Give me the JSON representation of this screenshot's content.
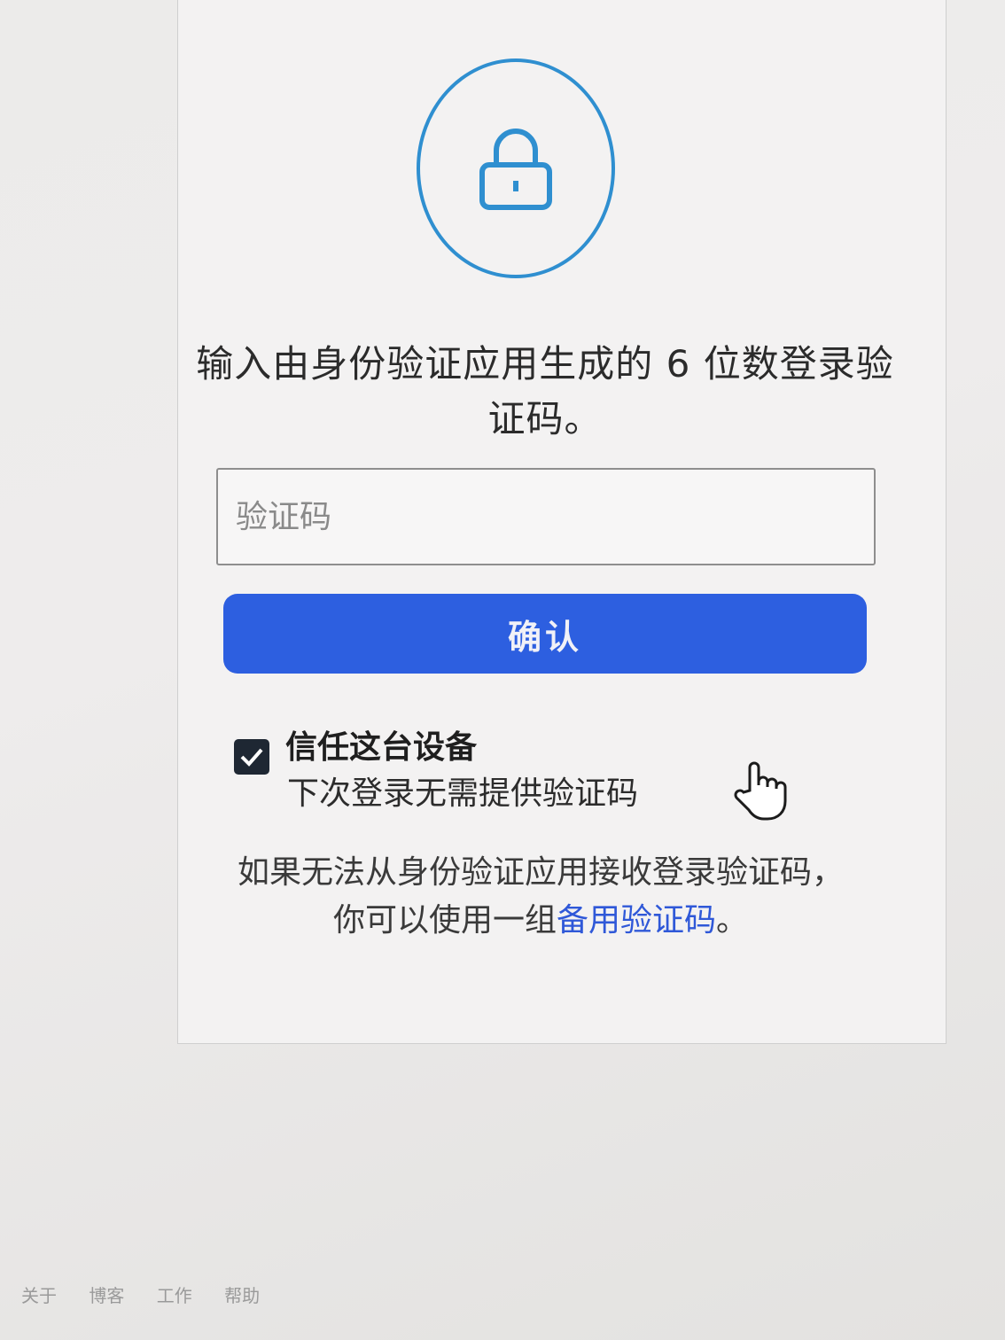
{
  "lock": {
    "icon": "lock-icon",
    "accent_color": "#2f8fd0"
  },
  "headline": "输入由身份验证应用生成的 6 位数登录验证码。",
  "code_input": {
    "placeholder": "验证码",
    "value": ""
  },
  "confirm_button": {
    "label": "确认",
    "color": "#2d5fe0"
  },
  "trust_device": {
    "checked": true,
    "title": "信任这台设备",
    "subtitle": "下次登录无需提供验证码"
  },
  "help": {
    "text": "如果无法从身份验证应用接收登录验证码，你可以使用一组",
    "link_label": "备用验证码",
    "suffix": "。"
  },
  "footer": {
    "links": [
      "关于",
      "博客",
      "工作",
      "帮助"
    ]
  }
}
